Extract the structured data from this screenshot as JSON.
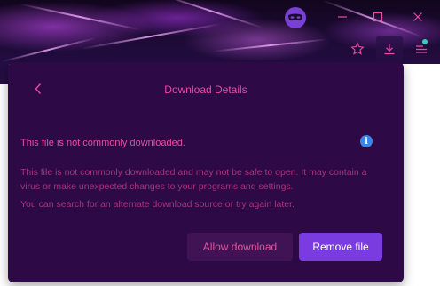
{
  "panel": {
    "title": "Download Details",
    "warning_title": "This file is not commonly downloaded.",
    "description": "This file is not commonly downloaded and may not be safe to open. It may contain a virus or make unexpected changes to your programs and settings.",
    "hint": "You can search for an alternate download source or try again later.",
    "allow_button": "Allow download",
    "remove_button": "Remove file"
  },
  "colors": {
    "accent_pink": "#e94aa6",
    "panel_bg": "#2d0a45",
    "primary_button": "#7a3ce0",
    "info_blue": "#3a86e8",
    "badge_teal": "#31d0b8"
  },
  "icons": {
    "profile": "incognito-mask-icon",
    "minimize": "minimize-icon",
    "maximize": "maximize-icon",
    "close": "close-icon",
    "favorite": "star-icon",
    "downloads": "download-icon",
    "menu": "menu-icon",
    "back": "chevron-left-icon",
    "info": "info-icon"
  }
}
